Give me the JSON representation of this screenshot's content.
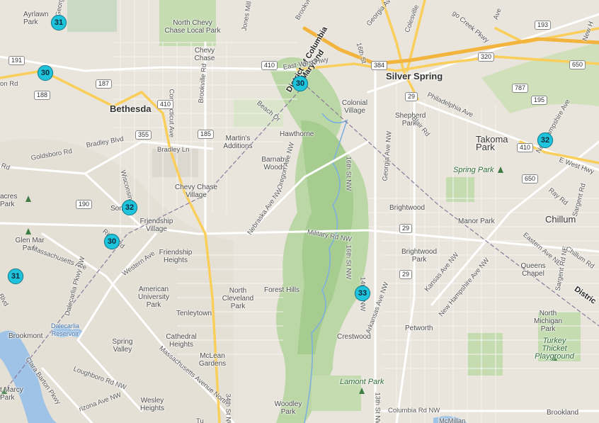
{
  "map": {
    "colors": {
      "land": "#e9e5dd",
      "park": "#c4dcb0",
      "forest": "#a9cf95",
      "water": "#9fc3e6",
      "marker": "#1fc3dc",
      "road": "#ffffff",
      "highway": "#f9ce5b"
    },
    "markers": [
      "31",
      "30",
      "30",
      "32",
      "30",
      "31",
      "33",
      "32"
    ],
    "cities": {
      "silver_spring": "Silver Spring",
      "bethesda": "Bethesda",
      "takoma_park": "Takoma Park",
      "chillum": "Chillum"
    },
    "places": {
      "ayrlawn_park": "Ayrlawn Park",
      "north_chevy_chase_local_park": "North Chevy Chase Local Park",
      "chevy_chase": "Chevy Chase",
      "colonial_village": "Colonial Village",
      "shepherd_park": "Shepherd Park",
      "hawthorne": "Hawthorne",
      "martins_additions": "Martin's Additions",
      "barnaby_woods": "Barnaby Woods",
      "chevy_chase_village": "Chevy Chase Village",
      "somerset": "Som",
      "friendship_village": "Friendship Village",
      "friendship_heights": "Friendship Heights",
      "brightwood": "Brightwood",
      "manor_park": "Manor Park",
      "brightwood_park": "Brightwood Park",
      "queens_chapel": "Queens Chapel",
      "north_michigan_park": "North Michigan Park",
      "american_university_park": "American University Park",
      "north_cleveland_park": "North Cleveland Park",
      "forest_hills": "Forest Hills",
      "tenleytown": "Tenleytown",
      "cathedral_heights": "Cathedral Heights",
      "spring_valley": "Spring Valley",
      "mclean_gardens": "McLean Gardens",
      "wesley_heights": "Wesley Heights",
      "woodley_park": "Woodley Park",
      "crestwood": "Crestwood",
      "petworth": "Petworth",
      "brookland": "Brookland",
      "brookmont": "Brookmont",
      "glen_mar_park": "Glen Mar Park",
      "acres_park": "acres Park",
      "marcy_park": "t Marcy Park",
      "dalecarlia_reservoir": "Dalecarlia Reservoir",
      "spring_park": "Spring Park",
      "lamont_park": "Lamont Park",
      "turkey_thicket": "Turkey Thicket Playground"
    },
    "borders": {
      "maryland": "Maryland",
      "dc": "District of Columbia",
      "dc_right": "Distric"
    },
    "roads": {
      "georgetown_rd": "Georgetown Rd",
      "jones_mill": "Jones Mill",
      "brookville": "Brookvi",
      "georgia_ave_n": "Georgia Ave",
      "colesville": "Colesville",
      "sligo_creek": "go Creek Pkwy",
      "ave_top": "Ave",
      "new_hampshire_top": "New H",
      "east_west_hwy": "East-West Hwy",
      "sixteenth_st": "16th St",
      "connecticut_ave": "Connecticut Ave",
      "brookville_rd": "Brookville Rd",
      "beach_dr": "Beach Dr",
      "philadelphia_ave": "Philadelphia Ave",
      "blair_rd": "Blair Rd",
      "new_hampshire_ave": "New Hampshire Ave",
      "e_west_hwy": "E West Hwy",
      "bradley_blvd": "Bradley Blvd",
      "bradley_ln": "Bradley Ln",
      "goldsboro_rd": "Goldsboro Rd",
      "wisconsin_ave": "Wisconsin Ave",
      "oregon_ave": "Oregon Ave NW",
      "sixteenth_st_nw": "16th St NW",
      "georgia_ave_nw": "Georgia Ave NW",
      "nebraska_ave": "Nebraska Ave NW",
      "military_rd": "Military Rd NW",
      "river_rd": "River Rd",
      "western_ave": "Western Ave",
      "massachusetts_ave": "Massachusetts Ave",
      "massachusetts_ave_nw": "Massachusetts Avenue North",
      "dalecarlia_pkwy": "Dalecarlia Pkwy NW",
      "clara_barton": "Clara Barton Pkwy",
      "loughboro_rd": "Loughboro Rd NW",
      "arizona_ave": "rizona Ave NW",
      "thirtyfourth_st": "34th St NW",
      "fourteenth_st": "14th St NW",
      "thirteenth_st": "13th St NW",
      "arkansas_ave": "Arkansas Ave NW",
      "kansas_ave": "Kansas Ave NW",
      "new_hampshire_ave_nw": "New Hampshire Ave NW",
      "eastern_ave": "Eastern Ave NE",
      "chillum_rd": "Chillum Rd",
      "sargent_rd": "Sargent Rd",
      "sargent_rd_ne": "Sargent Rd NE",
      "ray_rd": "Ray Rd",
      "columbia_rd": "Columbia Rd NW",
      "on_rd": "on Rd",
      "rd_left": "Rd",
      "blvd_left": "Blvd",
      "mcmillan": "McMillan",
      "tu": "Tu"
    },
    "shields": [
      "191",
      "188",
      "187",
      "410",
      "355",
      "185",
      "410",
      "384",
      "29",
      "320",
      "787",
      "195",
      "650",
      "193",
      "410",
      "650",
      "29",
      "29",
      "190"
    ]
  }
}
